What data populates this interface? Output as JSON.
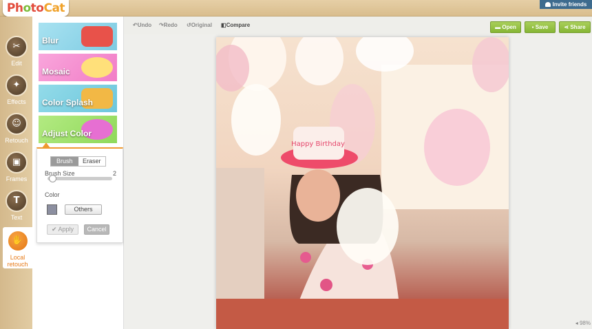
{
  "app": {
    "logo": "PhotoCat",
    "invite_label": "Invite friends"
  },
  "sidebar": {
    "items": [
      {
        "label": "Edit",
        "icon": "scissors-icon",
        "glyph": "✂"
      },
      {
        "label": "Effects",
        "icon": "magic-wand-icon",
        "glyph": "✦"
      },
      {
        "label": "Retouch",
        "icon": "face-icon",
        "glyph": "☺"
      },
      {
        "label": "Frames",
        "icon": "frame-icon",
        "glyph": "▣"
      },
      {
        "label": "Text",
        "icon": "text-icon",
        "glyph": "T"
      },
      {
        "label": "Local retouch",
        "icon": "hands-icon",
        "glyph": "✋"
      }
    ]
  },
  "panel": {
    "categories": [
      {
        "label": "Blur",
        "color": "#8fd3e8"
      },
      {
        "label": "Mosaic",
        "color": "#f58fd0"
      },
      {
        "label": "Color Splash",
        "color": "#7fd0e0"
      },
      {
        "label": "Adjust Color",
        "color": "#9be06a"
      }
    ],
    "tabs": {
      "brush": "Brush",
      "eraser": "Eraser"
    },
    "brush_size_label": "Brush Size",
    "brush_size_value": "2",
    "brush_size_fraction": 0.02,
    "color_label": "Color",
    "color_value": "#8c8fa0",
    "others_label": "Others",
    "apply_label": "Apply",
    "cancel_label": "Cancel"
  },
  "toolbar": {
    "undo": "Undo",
    "redo": "Redo",
    "original": "Original",
    "compare": "Compare",
    "open": "Open",
    "save": "Save",
    "share": "Share"
  },
  "status": {
    "zoom": "98%"
  }
}
